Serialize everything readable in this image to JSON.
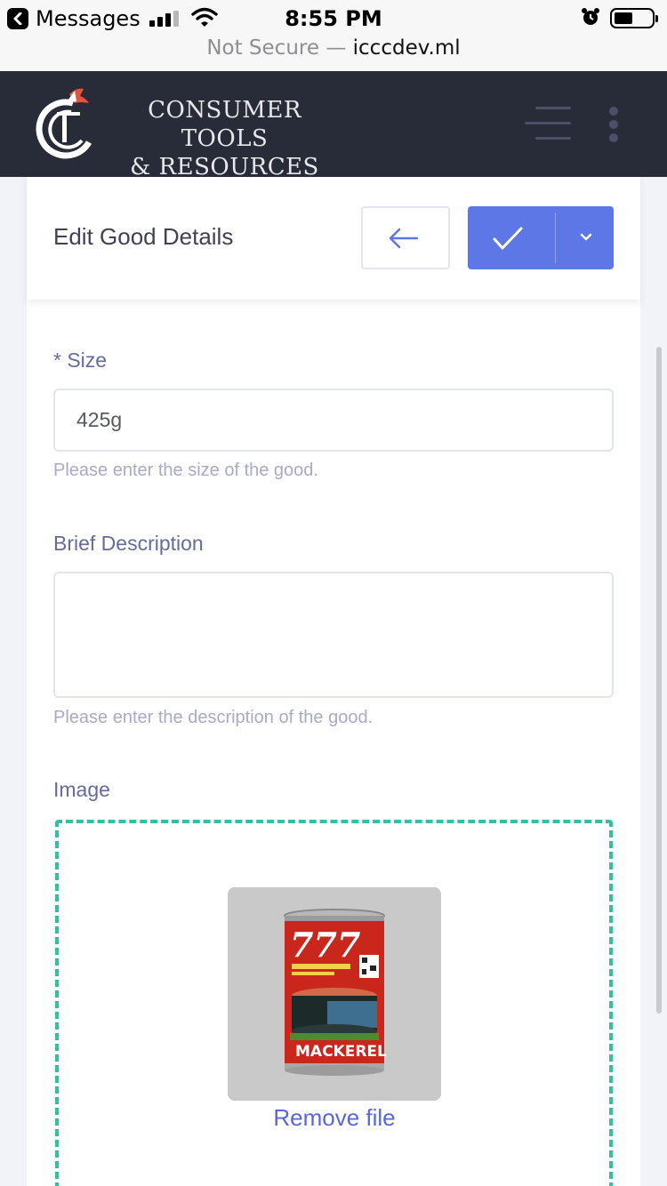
{
  "status_bar": {
    "back_app": "Messages",
    "time": "8:55 PM"
  },
  "url_bar": {
    "security": "Not Secure",
    "separator": "—",
    "host": "icccdev.ml"
  },
  "header": {
    "brand_line1": "CONSUMER TOOLS",
    "brand_line2": "& RESOURCES",
    "logo_icon": "ctr-logo-icon",
    "menu_icon": "hamburger-icon",
    "more_icon": "kebab-icon",
    "background": "#282b38"
  },
  "toolbar": {
    "title": "Edit Good Details",
    "back_icon": "arrow-left-icon",
    "save_icon": "check-icon",
    "dropdown_icon": "chevron-down-icon",
    "accent": "#5d78e6"
  },
  "form": {
    "size": {
      "label": "* Size",
      "value": "425g",
      "help": "Please enter the size of the good."
    },
    "description": {
      "label": "Brief Description",
      "value": "",
      "help": "Please enter the description of the good."
    },
    "image": {
      "label": "Image",
      "preview_can_brand": "777",
      "preview_can_label": "MACKEREL",
      "remove_label": "Remove file",
      "border_color": "#34bfa3"
    }
  }
}
